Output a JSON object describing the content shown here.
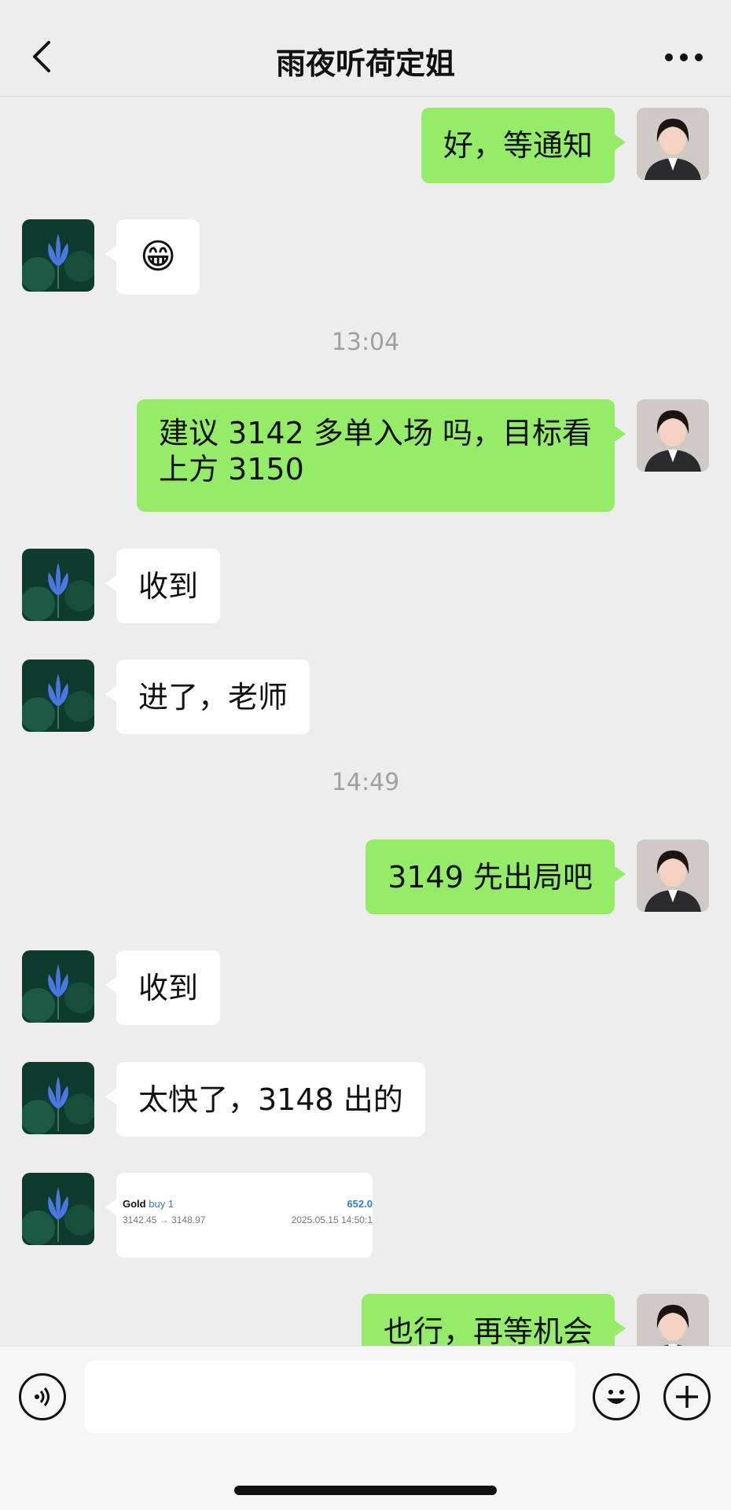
{
  "header": {
    "title": "雨夜听荷定姐"
  },
  "messages": {
    "m1": "好，等通知",
    "m2_emoji": "😁",
    "t1": "13:04",
    "m3_line1": "建议 3142 多单入场 吗，目标看",
    "m3_line2": "上方 3150",
    "m4": "收到",
    "m5": "进了，老师",
    "t2": "14:49",
    "m6": "3149 先出局吧",
    "m7": "收到",
    "m8": "太快了，3148 出的",
    "m9": "也行，再等机会"
  },
  "trade_card": {
    "symbol": "Gold",
    "side": "buy 1",
    "profit": "652.0",
    "prices": "3142.45 → 3148.97",
    "datetime": "2025.05.15 14:50:1"
  },
  "colors": {
    "my_bubble": "#95ec69",
    "their_bubble": "#ffffff",
    "background": "#ededed"
  }
}
